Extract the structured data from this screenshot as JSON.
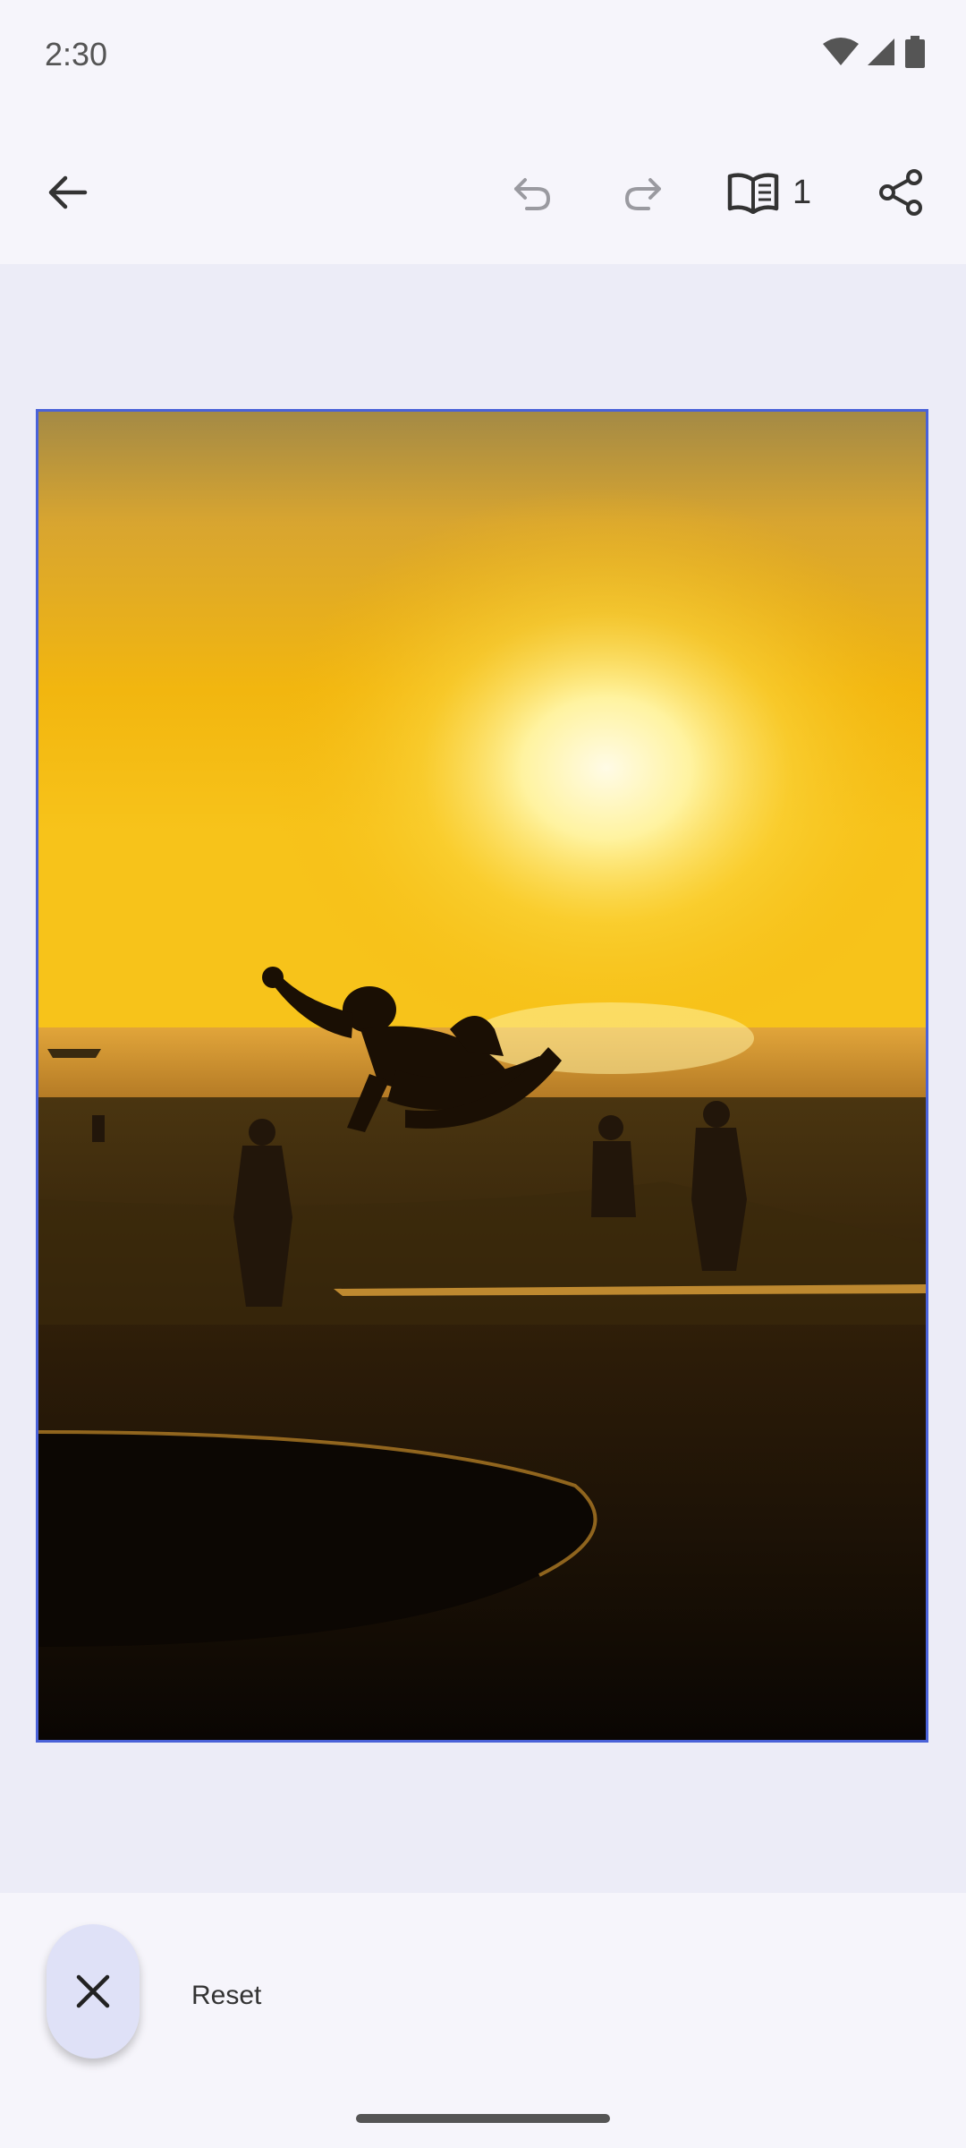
{
  "status_bar": {
    "time": "2:30",
    "icons": [
      "wifi-icon",
      "signal-icon",
      "battery-icon"
    ]
  },
  "toolbar": {
    "back_icon": "arrow-back-icon",
    "undo_icon": "undo-icon",
    "redo_icon": "redo-icon",
    "pages_icon": "book-icon",
    "page_count": "1",
    "share_icon": "share-icon"
  },
  "canvas": {
    "image_description_icon": "photo-sunset-skateboarder",
    "frame_color": "#4a62d8"
  },
  "bottom_bar": {
    "close_icon": "close-icon",
    "reset_label": "Reset"
  },
  "colors": {
    "background": "#f6f5fb",
    "canvas": "#ececf7",
    "accent": "#4a62d8",
    "fab": "#dfe1f7"
  }
}
